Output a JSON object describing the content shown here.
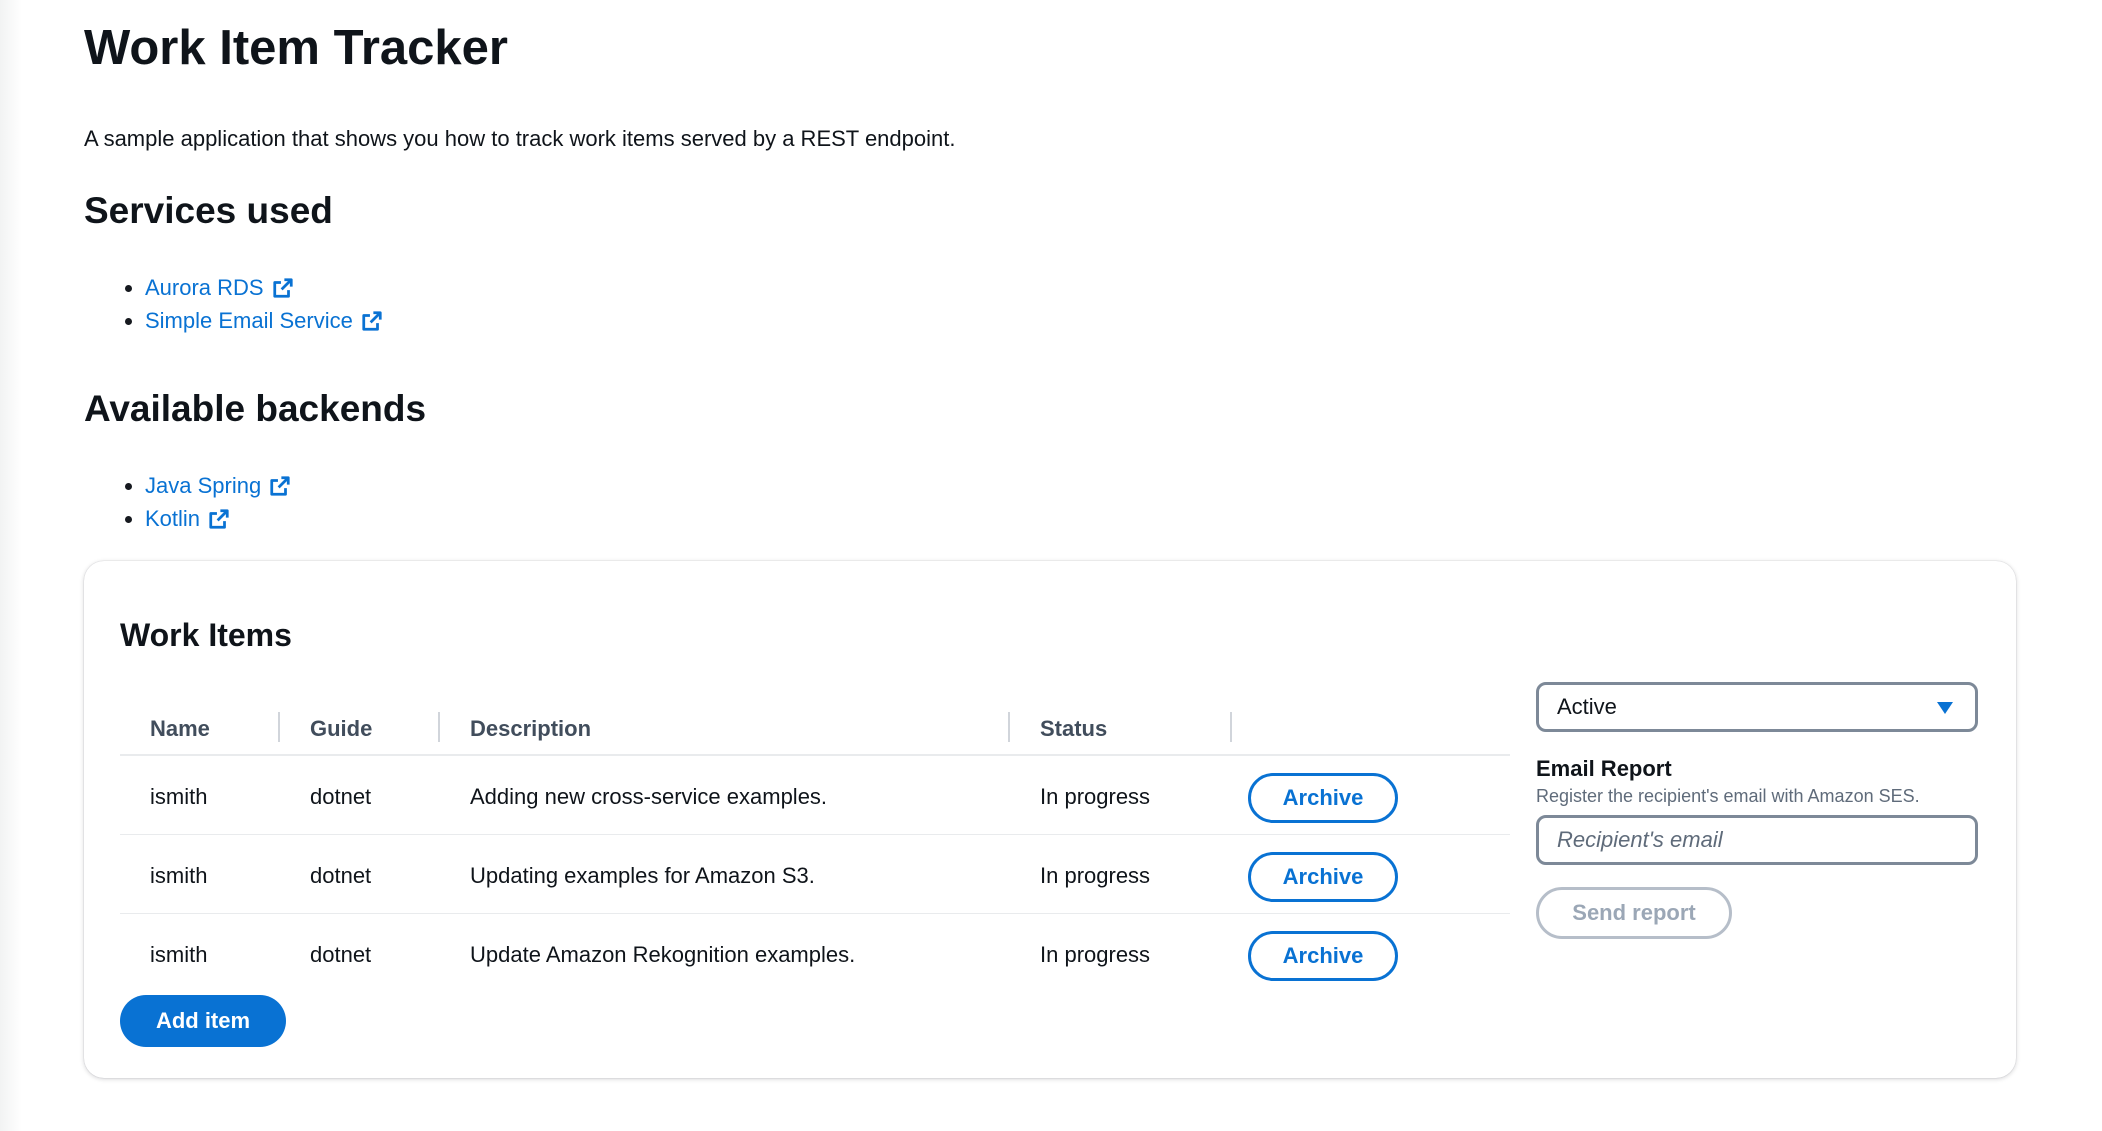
{
  "page": {
    "title": "Work Item Tracker",
    "description": "A sample application that shows you how to track work items served by a REST endpoint."
  },
  "services": {
    "heading": "Services used",
    "links": [
      {
        "label": "Aurora RDS",
        "icon": "external-link-icon"
      },
      {
        "label": "Simple Email Service",
        "icon": "external-link-icon"
      }
    ]
  },
  "backends": {
    "heading": "Available backends",
    "links": [
      {
        "label": "Java Spring",
        "icon": "external-link-icon"
      },
      {
        "label": "Kotlin",
        "icon": "external-link-icon"
      }
    ]
  },
  "work_items": {
    "title": "Work Items",
    "columns": [
      "Name",
      "Guide",
      "Description",
      "Status"
    ],
    "rows": [
      {
        "name": "ismith",
        "guide": "dotnet",
        "description": "Adding new cross-service examples.",
        "status": "In progress",
        "action": "Archive"
      },
      {
        "name": "ismith",
        "guide": "dotnet",
        "description": "Updating examples for Amazon S3.",
        "status": "In progress",
        "action": "Archive"
      },
      {
        "name": "ismith",
        "guide": "dotnet",
        "description": "Update Amazon Rekognition examples.",
        "status": "In progress",
        "action": "Archive"
      }
    ],
    "add_label": "Add item"
  },
  "report": {
    "filter_value": "Active",
    "email_label": "Email Report",
    "email_description": "Register the recipient's email with Amazon SES.",
    "email_placeholder": "Recipient's email",
    "email_value": "",
    "send_label": "Send report"
  },
  "colors": {
    "link": "#0972d3",
    "primary_button": "#0972d3",
    "disabled": "#9ba7b6",
    "heading": "#0f141a"
  }
}
